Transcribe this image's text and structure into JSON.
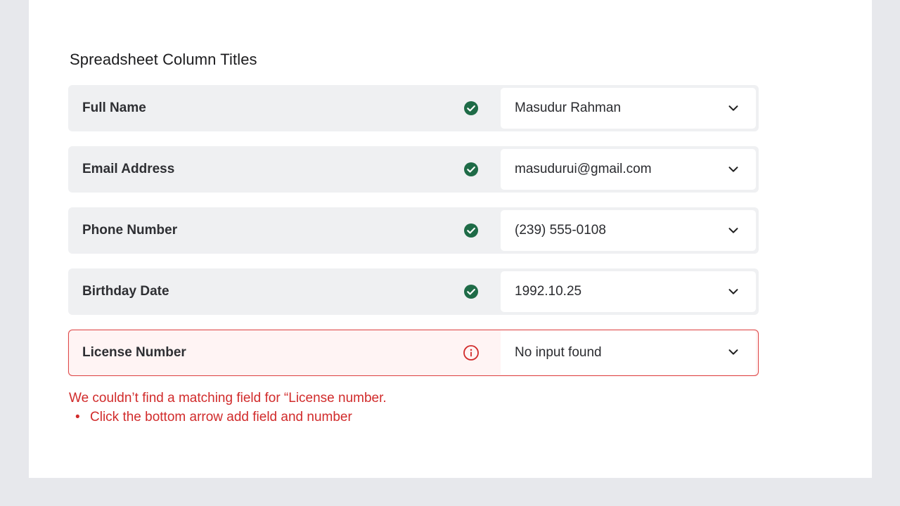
{
  "section": {
    "title": "Spreadsheet Column Titles"
  },
  "rows": [
    {
      "label": "Full Name",
      "value": "Masudur Rahman",
      "status": "check-icon"
    },
    {
      "label": "Email Address",
      "value": "masudurui@gmail.com",
      "status": "check-icon"
    },
    {
      "label": "Phone Number",
      "value": "(239) 555-0108",
      "status": "check-icon"
    },
    {
      "label": "Birthday Date",
      "value": "1992.10.25",
      "status": "check-icon"
    },
    {
      "label": "License Number",
      "value": "No input found",
      "status": "info-icon"
    }
  ],
  "error": {
    "message": "We couldn’t find a matching field for “License number.",
    "bullet": "•",
    "hint": "Click the bottom arrow add field and number"
  },
  "colors": {
    "success": "#1e6b47",
    "error": "#d12b2b",
    "row_bg": "#eff0f2",
    "error_row_bg": "#fff4f4"
  }
}
